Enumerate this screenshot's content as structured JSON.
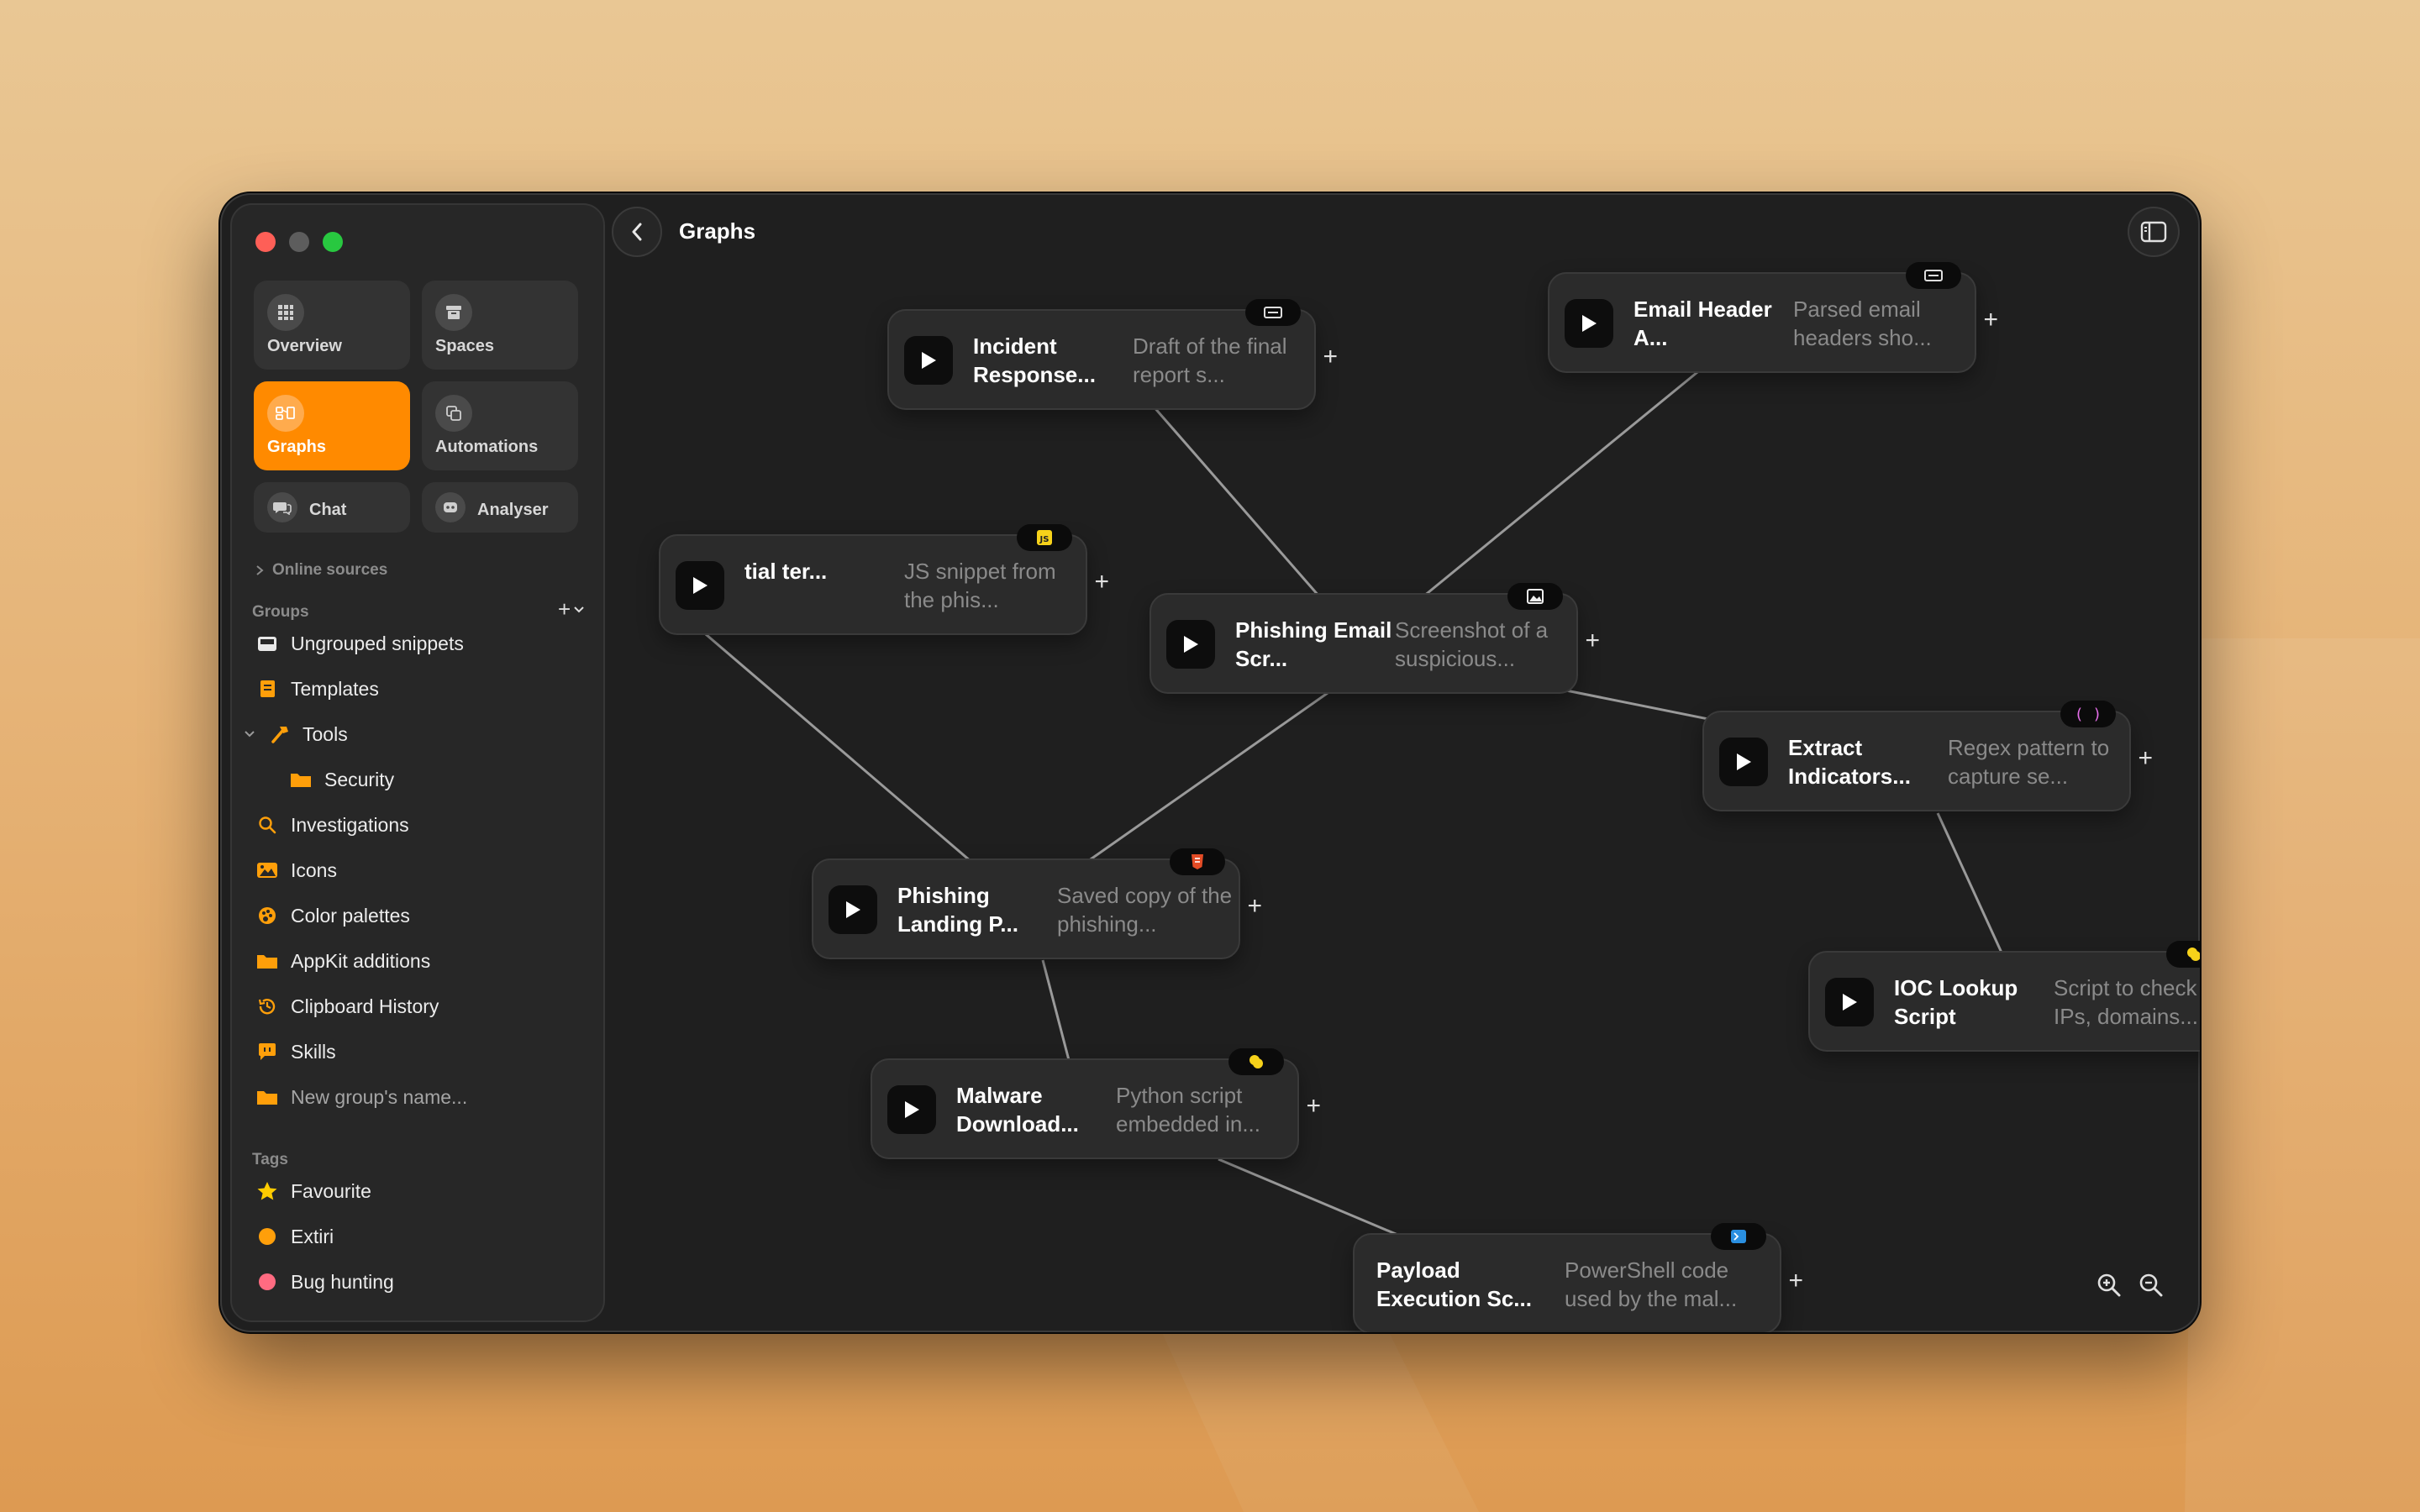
{
  "app": {
    "title": "Graphs"
  },
  "sidebar": {
    "tiles": [
      {
        "label": "Overview",
        "icon": "grid-icon"
      },
      {
        "label": "Spaces",
        "icon": "archive-icon"
      },
      {
        "label": "Graphs",
        "icon": "graph-icon",
        "active": true
      },
      {
        "label": "Automations",
        "icon": "copy-icon"
      },
      {
        "label": "Chat",
        "icon": "chat-icon"
      },
      {
        "label": "Analyser",
        "icon": "robot-icon"
      }
    ],
    "online_sources": "Online sources",
    "groups_label": "Groups",
    "groups": [
      {
        "label": "Ungrouped snippets",
        "icon": "inbox-icon"
      },
      {
        "label": "Templates",
        "icon": "template-icon"
      },
      {
        "label": "Tools",
        "icon": "hammer-icon"
      },
      {
        "label": "Security",
        "icon": "folder-icon"
      },
      {
        "label": "Investigations",
        "icon": "search-icon"
      },
      {
        "label": "Icons",
        "icon": "image-icon"
      },
      {
        "label": "Color palettes",
        "icon": "palette-icon"
      },
      {
        "label": "AppKit additions",
        "icon": "folder-icon"
      },
      {
        "label": "Clipboard History",
        "icon": "history-icon"
      },
      {
        "label": "Skills",
        "icon": "message-icon"
      }
    ],
    "new_group_placeholder": "New group's name...",
    "tags_label": "Tags",
    "tags": [
      {
        "label": "Favourite",
        "color": "#ffcc00"
      },
      {
        "label": "Extiri",
        "color": "#ff9f0a"
      },
      {
        "label": "Bug hunting",
        "color": "#ff6b81"
      }
    ],
    "accent": "#ff8a00"
  },
  "graph": {
    "nodes": [
      {
        "title": "Incident Response...",
        "desc": "Draft of the final report s...",
        "badge": "text-icon"
      },
      {
        "title": "Email Header A...",
        "desc": "Parsed email headers sho...",
        "badge": "text-icon"
      },
      {
        "title": "tial ter...",
        "desc": "JS snippet from the phis...",
        "badge": "js-icon"
      },
      {
        "title": "Phishing Email Scr...",
        "desc": "Screenshot of a suspicious...",
        "badge": "image-icon"
      },
      {
        "title": "Extract Indicators...",
        "desc": "Regex pattern to capture se...",
        "badge": "regex-icon"
      },
      {
        "title": "Phishing Landing P...",
        "desc": "Saved copy of the phishing...",
        "badge": "html-icon"
      },
      {
        "title": "IOC Lookup Script",
        "desc": "Script to check IPs, domains...",
        "badge": "python-icon"
      },
      {
        "title": "Malware Download...",
        "desc": "Python script embedded in...",
        "badge": "python-icon"
      },
      {
        "title": "Payload Execution Sc...",
        "desc": "PowerShell code used by the mal...",
        "badge": "powershell-icon"
      }
    ]
  }
}
